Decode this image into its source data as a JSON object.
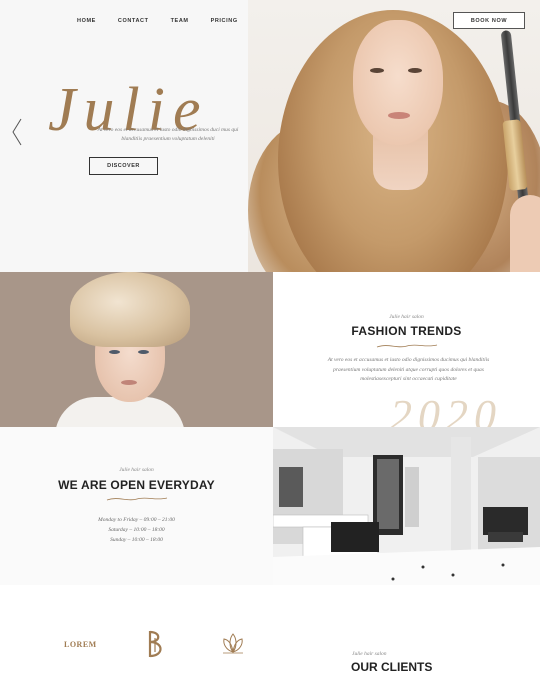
{
  "nav": {
    "items": [
      "HOME",
      "CONTACT",
      "TEAM",
      "PRICING"
    ],
    "book_label": "BOOK NOW"
  },
  "hero": {
    "script_title": "Julie",
    "description": "At vero eos et accusamus et iusto odio dignissimos duci mus qui blanditiis praesentium voluptatum deleniti",
    "discover_label": "DISCOVER"
  },
  "trends": {
    "kicker": "Julie hair salon",
    "title": "FASHION TRENDS",
    "description": "At vero eos et accusamus et iusto odio dignissimos ducimus qui blanditiis praesentium voluptatum deleniti atque corrupti quos dolores et quas molestiasexcepturi sint occaecati cupiditate",
    "decor_text": "2020"
  },
  "open": {
    "kicker": "Julie hair salon",
    "title": "WE ARE OPEN EVERYDAY",
    "hours": [
      "Monday to Friday – 09:00 – 21:00",
      "Saturday – 10:00 – 18:00",
      "Sunday – 10:00 – 18:00"
    ]
  },
  "clients": {
    "logo_text": "LOREM",
    "kicker": "Julie hair salon",
    "title": "OUR CLIENTS"
  },
  "colors": {
    "accent_gold": "#a07c53",
    "text_dark": "#222222"
  },
  "icons": [
    "chevron-left-icon",
    "b-logo-icon",
    "lotus-logo-icon"
  ]
}
